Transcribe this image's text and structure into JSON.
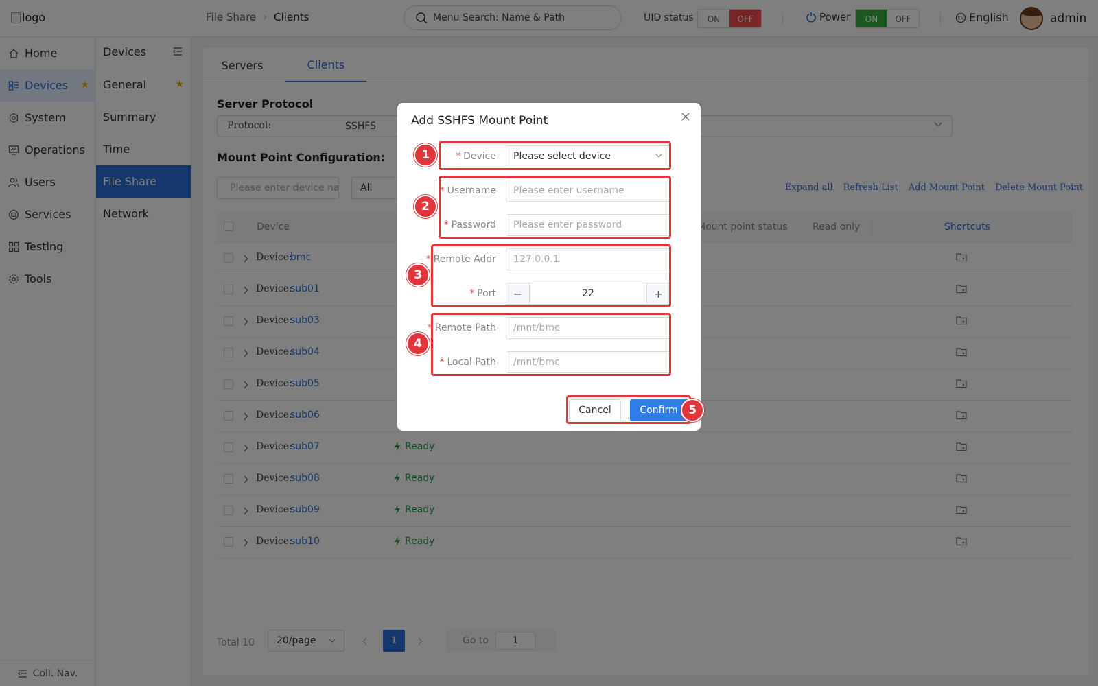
{
  "header": {
    "logo_alt": "logo",
    "breadcrumb": [
      "File Share",
      "Clients"
    ],
    "menu_search_placeholder": "Menu Search: Name & Path",
    "uid_label": "UID status",
    "uid_toggle": {
      "on": "ON",
      "off": "OFF",
      "state": "OFF"
    },
    "power_label": "Power",
    "power_toggle": {
      "on": "ON",
      "off": "OFF",
      "state": "ON"
    },
    "language": "English",
    "username": "admin"
  },
  "primary_nav": {
    "items": [
      {
        "label": "Home",
        "icon": "home-icon"
      },
      {
        "label": "Devices",
        "icon": "devices-icon",
        "active": true,
        "starred": true
      },
      {
        "label": "System",
        "icon": "system-icon"
      },
      {
        "label": "Operations",
        "icon": "operations-icon"
      },
      {
        "label": "Users",
        "icon": "users-icon"
      },
      {
        "label": "Services",
        "icon": "services-icon"
      },
      {
        "label": "Testing",
        "icon": "testing-icon"
      },
      {
        "label": "Tools",
        "icon": "tools-icon"
      }
    ],
    "collapse_label": "Coll. Nav."
  },
  "secondary_nav": {
    "title": "Devices",
    "items": [
      {
        "label": "General",
        "starred": true
      },
      {
        "label": "Summary"
      },
      {
        "label": "Time"
      },
      {
        "label": "File Share",
        "active": true
      },
      {
        "label": "Network"
      }
    ]
  },
  "main": {
    "tabs": [
      {
        "label": "Servers"
      },
      {
        "label": "Clients",
        "active": true
      }
    ],
    "server_protocol_title": "Server Protocol",
    "protocol_label": "Protocol:",
    "protocol_value": "SSHFS",
    "mount_config_title": "Mount Point Configuration:",
    "device_search_placeholder": "Please enter device name",
    "filter_value": "All",
    "actions": [
      "Expand all",
      "Refresh List",
      "Add Mount Point",
      "Delete Mount Point"
    ],
    "columns": {
      "device": "Device",
      "mount_status": "Mount point status",
      "read_only": "Read only",
      "shortcuts": "Shortcuts"
    },
    "device_prefix": "Device:",
    "rows": [
      {
        "device": "bmc",
        "status": ""
      },
      {
        "device": "sub01",
        "status": ""
      },
      {
        "device": "sub03",
        "status": ""
      },
      {
        "device": "sub04",
        "status": ""
      },
      {
        "device": "sub05",
        "status": ""
      },
      {
        "device": "sub06",
        "status": ""
      },
      {
        "device": "sub07",
        "status": "Ready"
      },
      {
        "device": "sub08",
        "status": "Ready"
      },
      {
        "device": "sub09",
        "status": "Ready"
      },
      {
        "device": "sub10",
        "status": "Ready"
      }
    ],
    "pagination": {
      "total": "Total 10",
      "page_size": "20/page",
      "current_page": "1",
      "goto_label": "Go to",
      "goto_value": "1"
    }
  },
  "dialog": {
    "title": "Add SSHFS Mount Point",
    "fields": {
      "device": {
        "label": "Device",
        "value": "Please select device"
      },
      "username": {
        "label": "Username",
        "placeholder": "Please enter username"
      },
      "password": {
        "label": "Password",
        "placeholder": "Please enter password"
      },
      "remote_addr": {
        "label": "Remote Addr",
        "placeholder": "127.0.0.1"
      },
      "port": {
        "label": "Port",
        "value": "22"
      },
      "remote_path": {
        "label": "Remote Path",
        "placeholder": "/mnt/bmc"
      },
      "local_path": {
        "label": "Local Path",
        "placeholder": "/mnt/bmc"
      }
    },
    "cancel_label": "Cancel",
    "confirm_label": "Confirm"
  },
  "annotations": [
    "1",
    "2",
    "3",
    "4",
    "5"
  ],
  "colors": {
    "accent": "#2b6fd6",
    "annotation": "#e0353b",
    "ready": "#1e9b40",
    "off_toggle": "#f04a4a",
    "on_toggle": "#38b03f"
  }
}
